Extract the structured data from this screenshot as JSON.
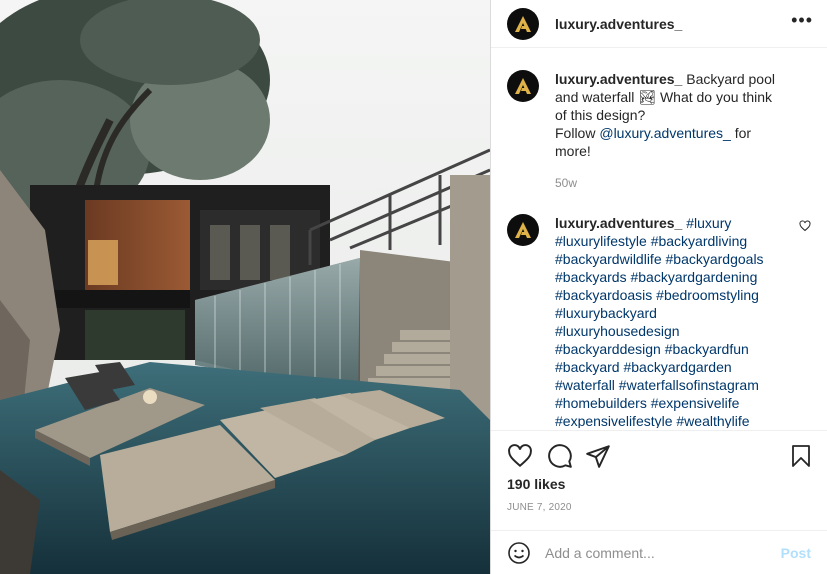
{
  "post": {
    "username": "luxury.adventures_",
    "more_icon": "ellipsis-icon",
    "caption": {
      "username": "luxury.adventures_",
      "text_before": " Backyard pool and waterfall ",
      "emoji": "🏞",
      "text_after": " What do you think of this design?",
      "follow_prefix": "Follow ",
      "mention": "@luxury.adventures_",
      "follow_suffix": " for more!",
      "time": "50w"
    },
    "comment": {
      "username": "luxury.adventures_",
      "hashtags": "#luxury #luxurylifestyle #backyardliving #backyardwildlife #backyardgoals #backyards #backyardgardening #backyardoasis #bedroomstyling #luxurybackyard #luxuryhousedesign #backyarddesign #backyardfun #backyard #backyardgarden #waterfall #waterfallsofinstagram #homebuilders #expensivelife #expensivelifestyle #wealthylife #wealthyminds #wealthymindset"
    },
    "likes": "190 likes",
    "date": "JUNE 7, 2020",
    "add_comment_placeholder": "Add a comment...",
    "post_label": "Post"
  }
}
